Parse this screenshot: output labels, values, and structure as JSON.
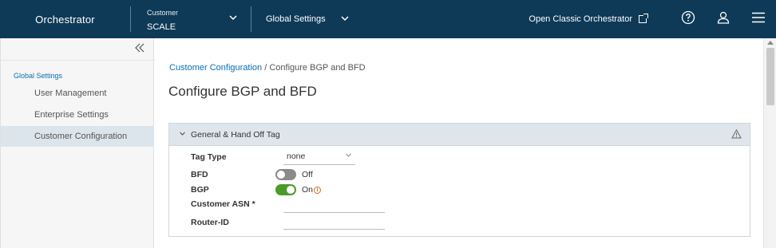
{
  "header": {
    "app_title": "Orchestrator",
    "customer_label": "Customer",
    "customer_value": "SCALE",
    "settings_menu": "Global Settings",
    "classic_link": "Open Classic Orchestrator"
  },
  "sidebar": {
    "section_title": "Global Settings",
    "items": [
      {
        "label": "User Management"
      },
      {
        "label": "Enterprise Settings"
      },
      {
        "label": "Customer Configuration"
      }
    ]
  },
  "breadcrumb": {
    "parent": "Customer Configuration",
    "separator": "/",
    "current": "Configure BGP and BFD"
  },
  "page_title": "Configure BGP and BFD",
  "panel": {
    "title": "General & Hand Off Tag",
    "fields": {
      "tag_type_label": "Tag Type",
      "tag_type_value": "none",
      "bfd_label": "BFD",
      "bfd_state": "Off",
      "bgp_label": "BGP",
      "bgp_state": "On",
      "customer_asn_label": "Customer ASN *",
      "customer_asn_value": "",
      "router_id_label": "Router-ID",
      "router_id_value": ""
    }
  },
  "colors": {
    "header_bg": "#0e3a57",
    "accent_link": "#0a6fb3",
    "toggle_on": "#4c9a2a",
    "toggle_off": "#8a8a8a",
    "panel_header": "#dfe6eb"
  }
}
